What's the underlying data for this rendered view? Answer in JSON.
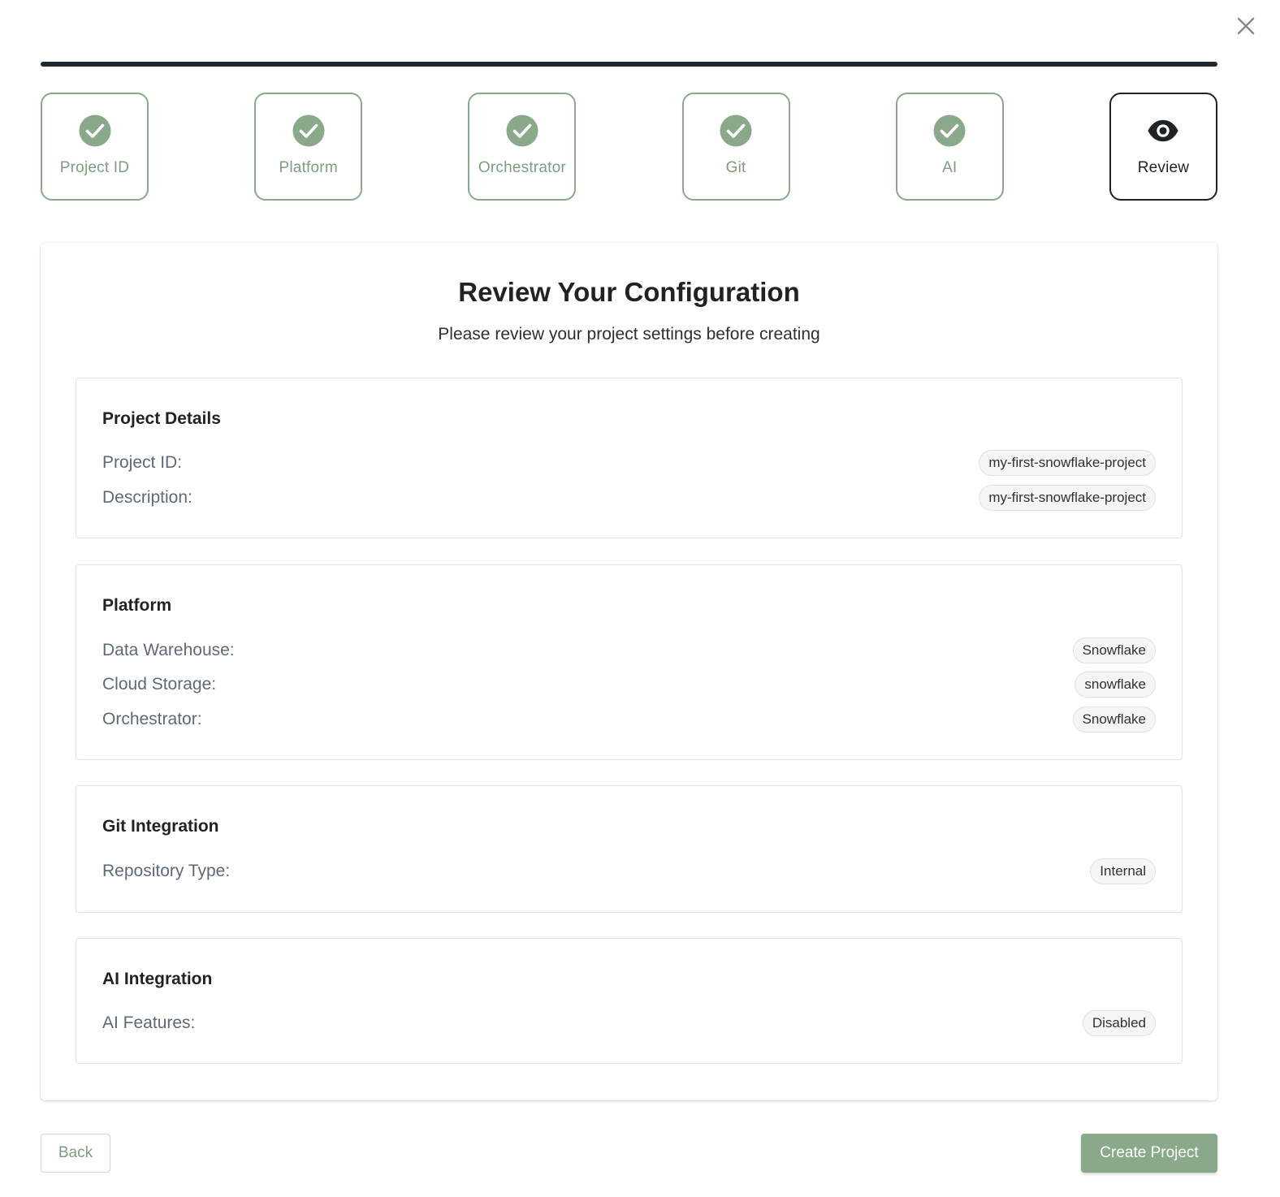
{
  "dialog": {
    "close_icon": "close-icon"
  },
  "steps": [
    {
      "label": "Project ID",
      "status": "complete",
      "icon": "check-circle-icon"
    },
    {
      "label": "Platform",
      "status": "complete",
      "icon": "check-circle-icon"
    },
    {
      "label": "Orchestrator",
      "status": "complete",
      "icon": "check-circle-icon"
    },
    {
      "label": "Git",
      "status": "complete",
      "icon": "check-circle-icon"
    },
    {
      "label": "AI",
      "status": "complete",
      "icon": "check-circle-icon"
    },
    {
      "label": "Review",
      "status": "active",
      "icon": "eye-icon"
    }
  ],
  "review": {
    "title": "Review Your Configuration",
    "subtitle": "Please review your project settings before creating",
    "sections": {
      "project": {
        "title": "Project Details",
        "rows": [
          {
            "key": "Project ID:",
            "value": "my-first-snowflake-project"
          },
          {
            "key": "Description:",
            "value": "my-first-snowflake-project"
          }
        ]
      },
      "platform": {
        "title": "Platform",
        "rows": [
          {
            "key": "Data Warehouse:",
            "value": "Snowflake"
          },
          {
            "key": "Cloud Storage:",
            "value": "snowflake"
          },
          {
            "key": "Orchestrator:",
            "value": "Snowflake"
          }
        ]
      },
      "git": {
        "title": "Git Integration",
        "rows": [
          {
            "key": "Repository Type:",
            "value": "Internal"
          }
        ]
      },
      "ai": {
        "title": "AI Integration",
        "rows": [
          {
            "key": "AI Features:",
            "value": "Disabled"
          }
        ]
      }
    }
  },
  "footer": {
    "back_label": "Back",
    "create_label": "Create Project"
  },
  "colors": {
    "accent": "#8aa98a",
    "dark": "#1e2a30",
    "label": "#5d6a75"
  }
}
